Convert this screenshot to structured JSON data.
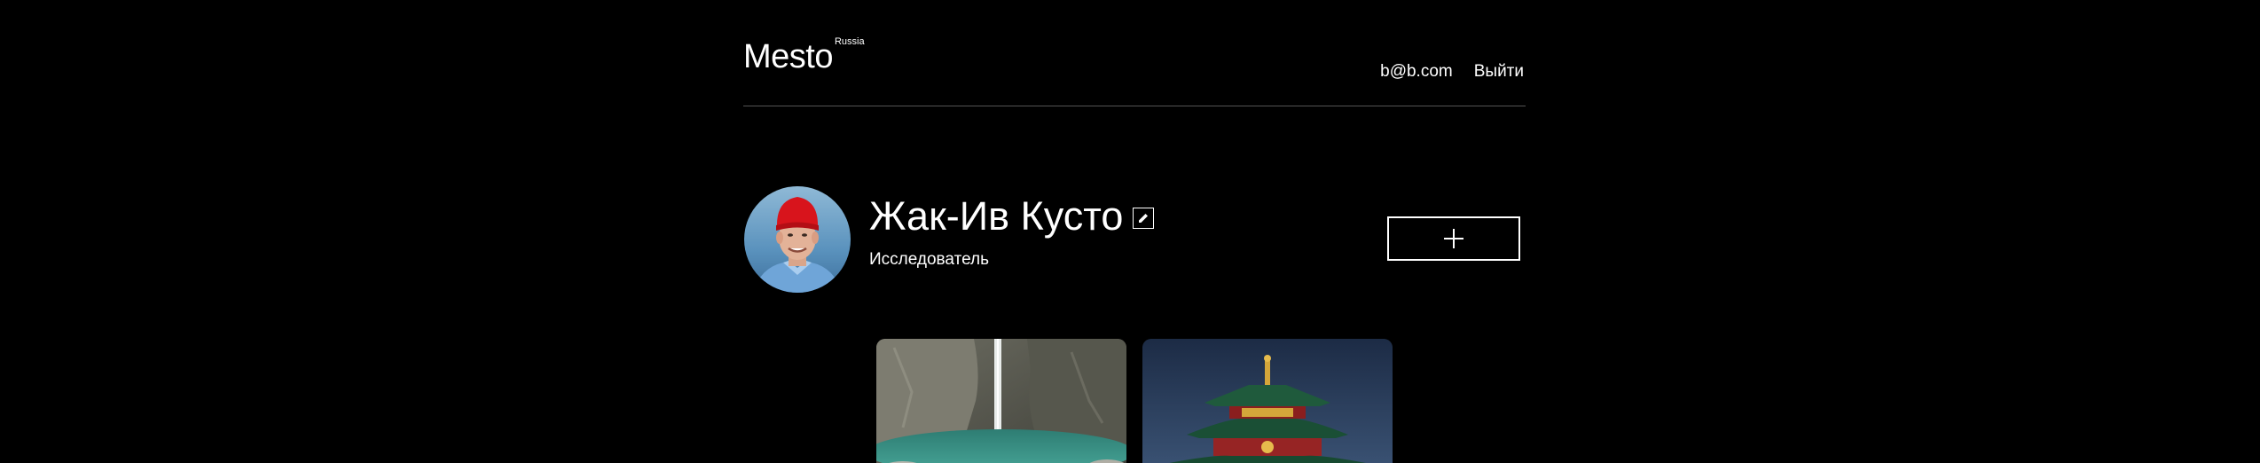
{
  "header": {
    "logo": "Mesto",
    "logo_sup": "Russia",
    "email": "b@b.com",
    "logout": "Выйти"
  },
  "profile": {
    "name": "Жак-Ив Кусто",
    "job": "Исследователь"
  },
  "colors": {
    "background": "#000000",
    "text": "#ffffff",
    "divider": "#545454"
  },
  "icons": {
    "edit": "pencil-icon",
    "add": "plus-icon"
  },
  "cards": [
    {
      "image": "waterfall-gorge"
    },
    {
      "image": "buddhist-temple"
    }
  ]
}
